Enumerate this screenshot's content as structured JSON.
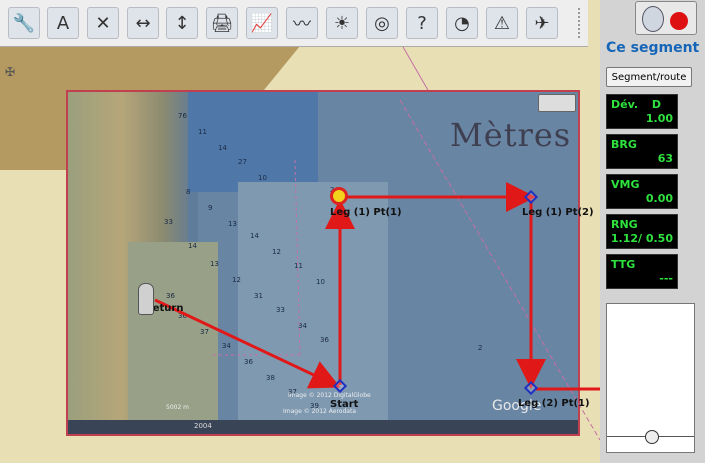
{
  "toolbar": {
    "buttons": [
      {
        "icon": "wrench-icon",
        "glyph": "🔧"
      },
      {
        "icon": "add-text-icon",
        "glyph": "A"
      },
      {
        "icon": "delete-icon",
        "glyph": "✕"
      },
      {
        "icon": "horizontal-scale-icon",
        "glyph": "↔"
      },
      {
        "icon": "vertical-scale-icon",
        "glyph": "↕"
      },
      {
        "icon": "printer-icon",
        "glyph": "🖨"
      },
      {
        "icon": "route-chart-icon",
        "glyph": "📈"
      },
      {
        "icon": "draw-route-icon",
        "glyph": "〰"
      },
      {
        "icon": "sunset-icon",
        "glyph": "☀"
      },
      {
        "icon": "lifebuoy-icon",
        "glyph": "◎"
      },
      {
        "icon": "help-icon",
        "glyph": "?"
      },
      {
        "icon": "instruments-icon",
        "glyph": "◔"
      },
      {
        "icon": "mob-alarm-icon",
        "glyph": "⚠"
      },
      {
        "icon": "helicopter-icon",
        "glyph": "✈"
      }
    ]
  },
  "chart": {
    "units_label": "Mètres",
    "waypoints": [
      {
        "label": "Leg (1) Pt(1)"
      },
      {
        "label": "Leg (1) Pt(2)"
      },
      {
        "label": "Start"
      },
      {
        "label": "Leg (2) Pt(1)"
      },
      {
        "label": "Return"
      }
    ],
    "depths": [
      "76",
      "11",
      "14",
      "27",
      "10",
      "8",
      "9",
      "13",
      "14",
      "12",
      "11",
      "10",
      "14",
      "13",
      "12",
      "31",
      "33",
      "34",
      "36",
      "33",
      "36",
      "36",
      "37",
      "34",
      "36",
      "38",
      "37",
      "39",
      "2",
      "24"
    ],
    "overlay_credit": "Image © 2012 DigitalGlobe",
    "overlay_credit2": "Image © 2012 Aerodata",
    "overlay_logo": "Google",
    "overlay_year": "2004",
    "scale_label": "5002 m"
  },
  "panel": {
    "title": "Ce segment",
    "segment_button": "Segment/route",
    "instruments": [
      {
        "label": "Dév.",
        "value_top": "D",
        "value": "1.00"
      },
      {
        "label": "BRG",
        "value": "63"
      },
      {
        "label": "VMG",
        "value": "0.00"
      },
      {
        "label": "RNG",
        "value": "1.12/ 0.50"
      },
      {
        "label": "TTG",
        "value": "---"
      }
    ]
  },
  "colors": {
    "route": "#e01818",
    "waypoint": "#2030c0",
    "instrument_text": "#2ee33e",
    "panel_title": "#1565b8"
  }
}
